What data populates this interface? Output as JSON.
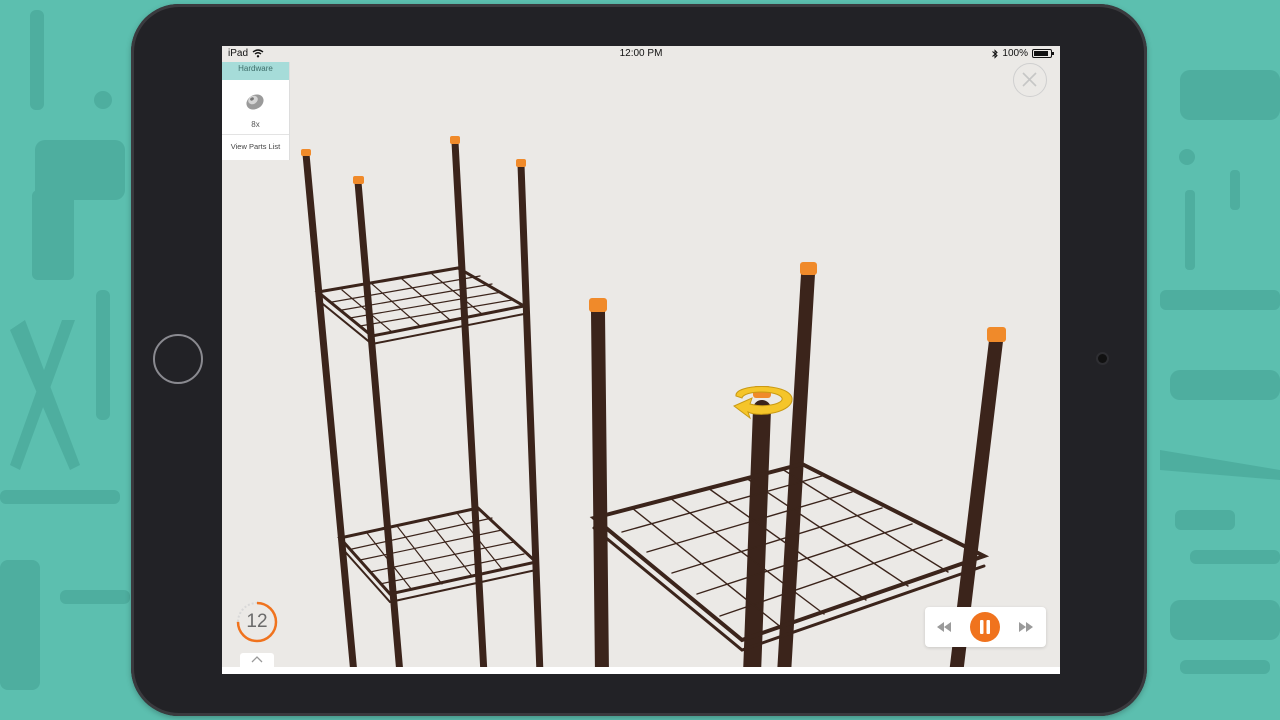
{
  "status": {
    "device": "iPad",
    "time": "12:00 PM",
    "battery_pct": "100%",
    "battery_level": 1.0
  },
  "hardware_panel": {
    "header": "Hardware",
    "part_icon": "screw-cap-icon",
    "quantity": "8x",
    "view_parts_link": "View Parts List"
  },
  "step": {
    "number": "12",
    "progress_fraction": 0.75
  },
  "player": {
    "rewind_icon": "rewind-icon",
    "pause_icon": "pause-icon",
    "forward_icon": "fast-forward-icon"
  },
  "close_icon": "close-icon",
  "colors": {
    "background": "#5cbfaf",
    "accent_orange": "#f0731e",
    "hardware_header": "#a6dcd9",
    "frame": "#3b241b"
  }
}
